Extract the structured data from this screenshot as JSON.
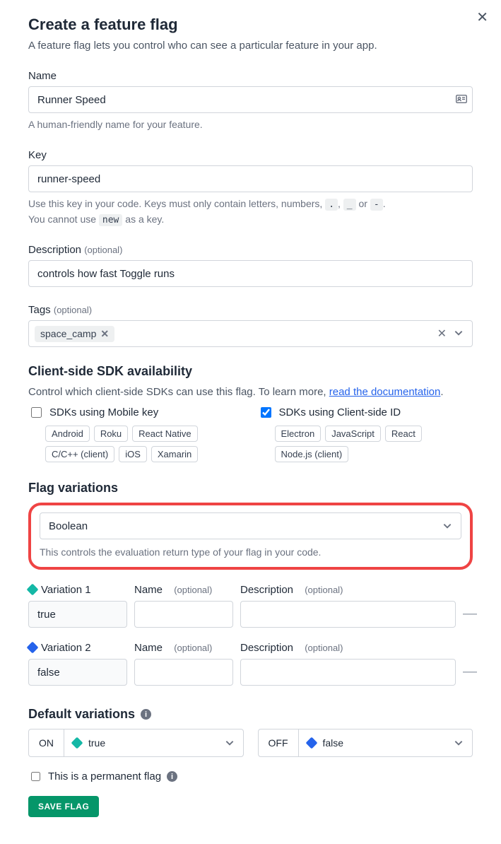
{
  "title": "Create a feature flag",
  "subtitle": "A feature flag lets you control who can see a particular feature in your app.",
  "name": {
    "label": "Name",
    "value": "Runner Speed",
    "help": "A human-friendly name for your feature."
  },
  "key": {
    "label": "Key",
    "value": "runner-speed",
    "help_prefix": "Use this key in your code. Keys must only contain letters, numbers, ",
    "code1": ".",
    "sep1": ", ",
    "code2": "_",
    "sep2": " or ",
    "code3": "-",
    "suffix1": ".",
    "line2_prefix": "You cannot use ",
    "code4": "new",
    "line2_suffix": " as a key."
  },
  "description": {
    "label": "Description",
    "optional": "(optional)",
    "value": "controls how fast Toggle runs"
  },
  "tags": {
    "label": "Tags",
    "optional": "(optional)",
    "chip": "space_camp"
  },
  "sdk": {
    "heading": "Client-side SDK availability",
    "body_prefix": "Control which client-side SDKs can use this flag. To learn more, ",
    "link": "read the documentation",
    "body_suffix": ".",
    "mobile_label": "SDKs using Mobile key",
    "client_label": "SDKs using Client-side ID",
    "mobile_tags": [
      "Android",
      "Roku",
      "React Native",
      "C/C++ (client)",
      "iOS",
      "Xamarin"
    ],
    "client_tags": [
      "Electron",
      "JavaScript",
      "React",
      "Node.js (client)"
    ]
  },
  "variations": {
    "heading": "Flag variations",
    "type": "Boolean",
    "help": "This controls the evaluation return type of your flag in your code.",
    "var1_label": "Variation 1",
    "var2_label": "Variation 2",
    "name_label": "Name",
    "desc_label": "Description",
    "optional": "(optional)",
    "var1_value": "true",
    "var2_value": "false"
  },
  "defaults": {
    "heading": "Default variations",
    "on": "ON",
    "off": "OFF",
    "on_value": "true",
    "off_value": "false"
  },
  "permanent_label": "This is a permanent flag",
  "save": "SAVE FLAG"
}
